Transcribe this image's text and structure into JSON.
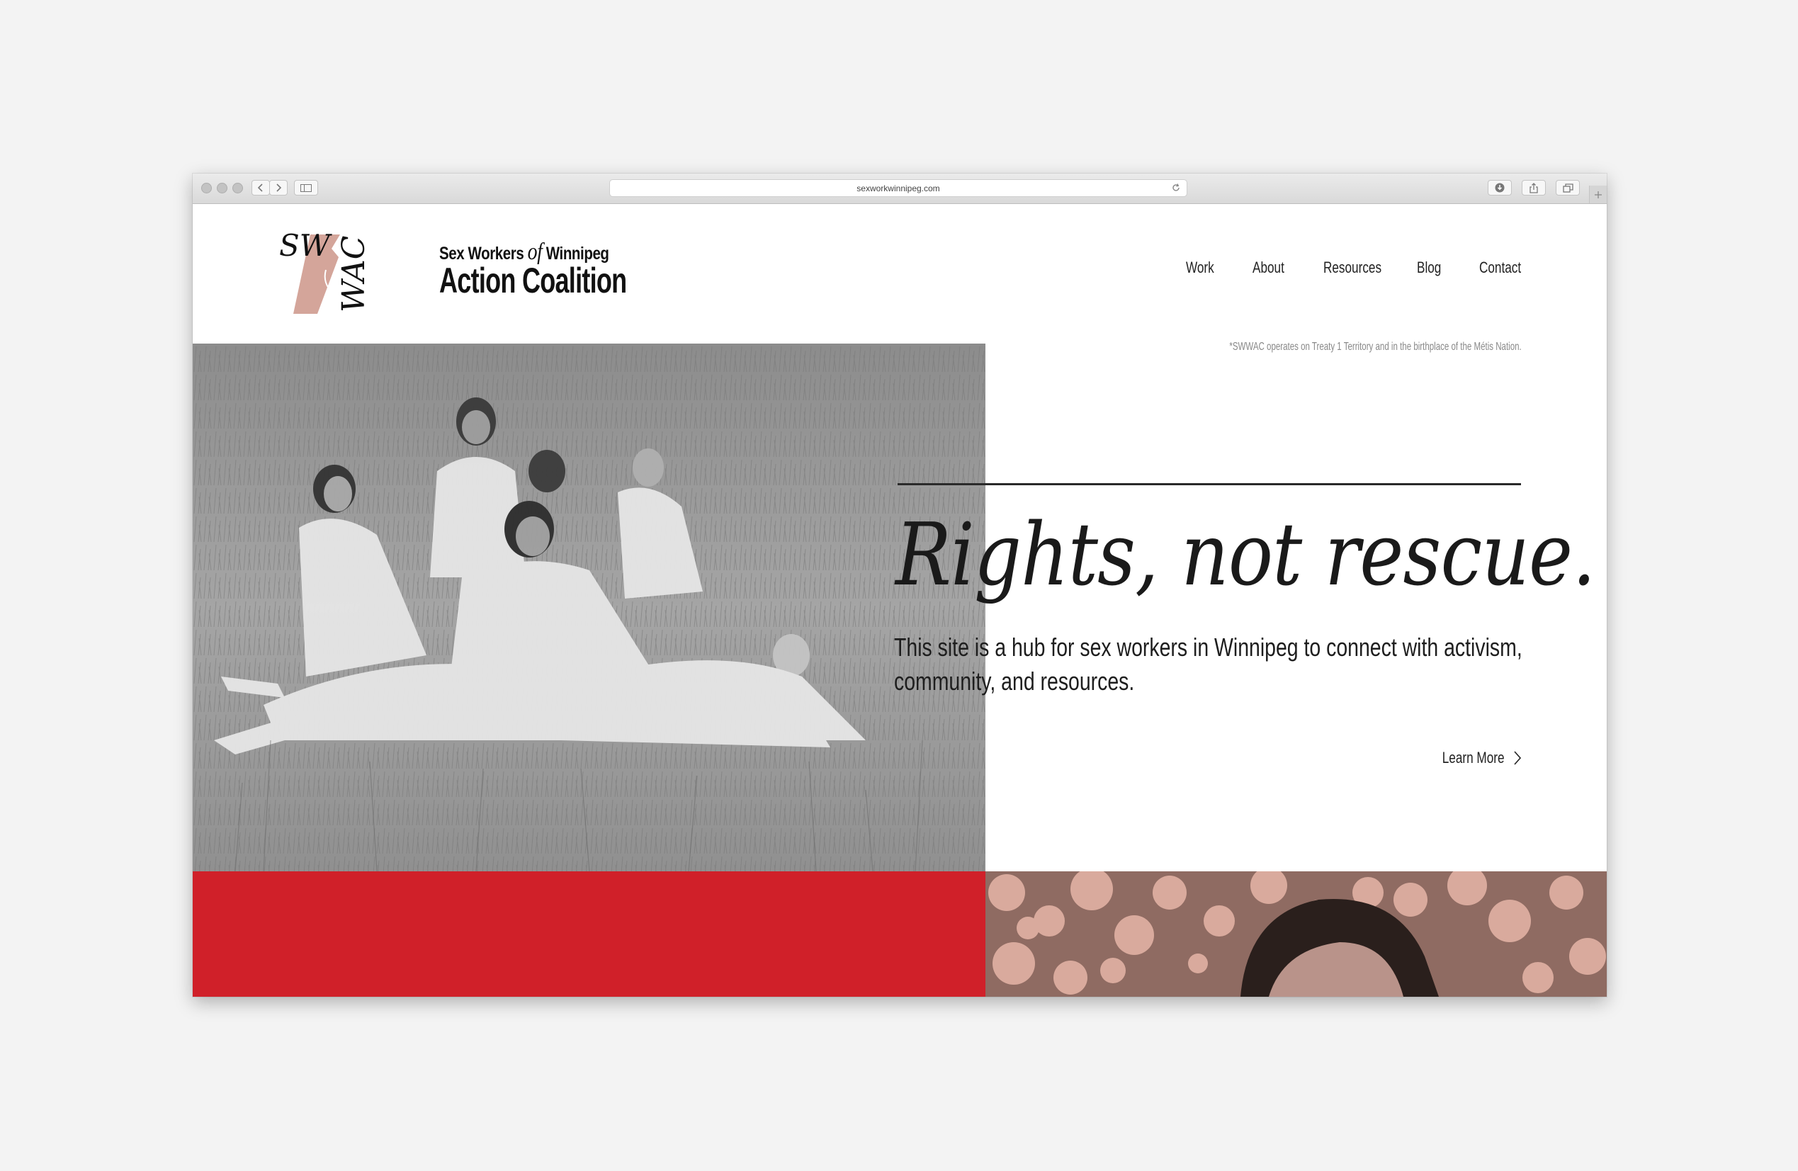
{
  "browser": {
    "url": "sexworkwinnipeg.com"
  },
  "brand": {
    "mark_top": "SW",
    "mark_side": "WAC",
    "line1_before": "Sex Workers",
    "line1_of": "of",
    "line1_after": "Winnipeg",
    "line2": "Action Coalition"
  },
  "nav": {
    "items": [
      "Work",
      "About",
      "Resources",
      "Blog",
      "Contact"
    ]
  },
  "acknowledgement": "*SWWAC operates on Treaty 1 Territory and in the birthplace of the Métis Nation.",
  "hero": {
    "headline": "Rights, not rescue.",
    "subtext": "This site is a hub for sex workers in Winnipeg to connect with activism, community, and resources.",
    "cta": "Learn More"
  },
  "colors": {
    "background": "#f3f3f3",
    "accent_red": "#d02029",
    "accent_pink": "#d4a59a",
    "text": "#1a1a1a"
  },
  "icons": [
    "back-arrow-icon",
    "forward-arrow-icon",
    "sidebar-icon",
    "reload-icon",
    "download-icon",
    "share-icon",
    "tabs-icon",
    "plus-icon",
    "chevron-right-icon"
  ]
}
